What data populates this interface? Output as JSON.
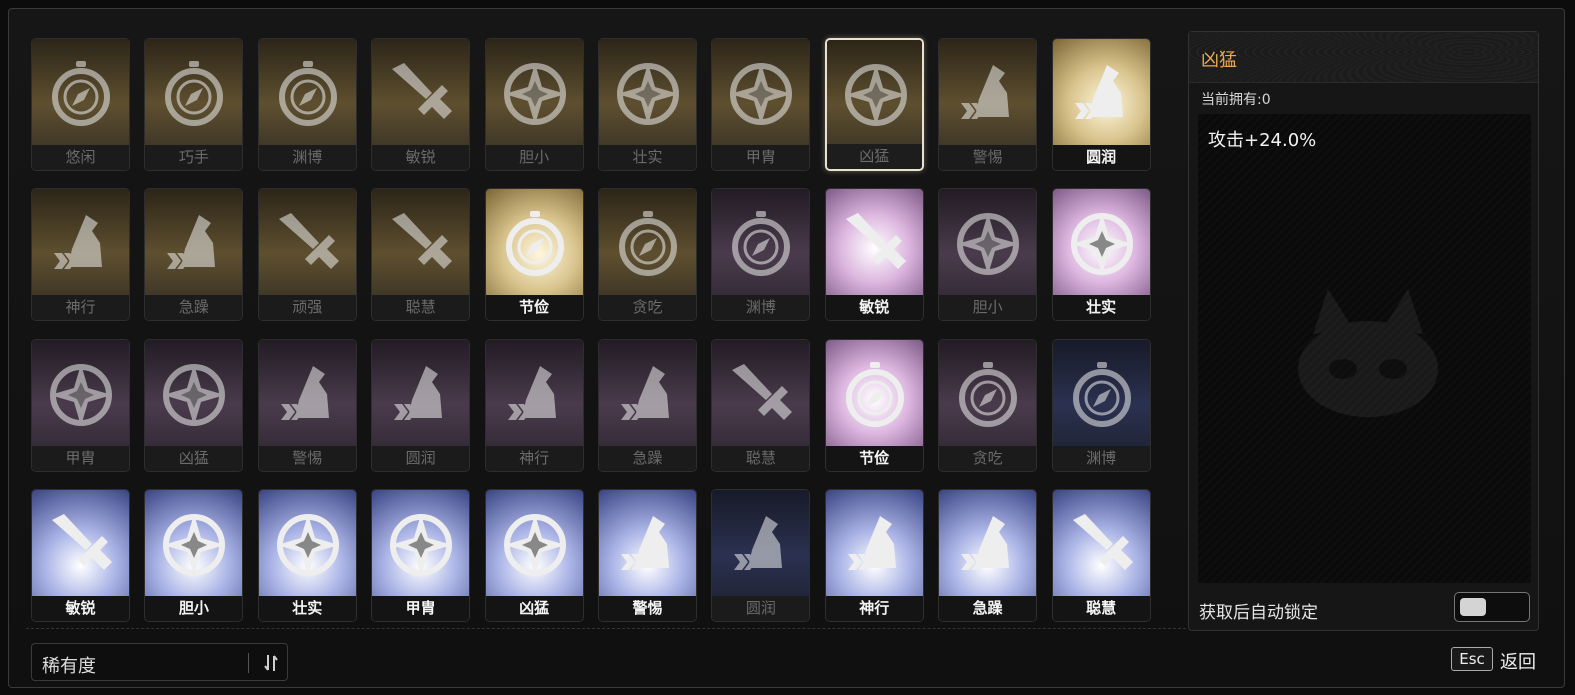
{
  "cards": [
    {
      "label": "悠闲",
      "icon": "compass-icon",
      "tint": "gold",
      "bright": false,
      "selected": false
    },
    {
      "label": "巧手",
      "icon": "compass-icon",
      "tint": "gold",
      "bright": false,
      "selected": false
    },
    {
      "label": "渊博",
      "icon": "compass-icon",
      "tint": "gold",
      "bright": false,
      "selected": false
    },
    {
      "label": "敏锐",
      "icon": "sword-icon",
      "tint": "gold",
      "bright": false,
      "selected": false
    },
    {
      "label": "胆小",
      "icon": "star-shield-icon",
      "tint": "gold",
      "bright": false,
      "selected": false
    },
    {
      "label": "壮实",
      "icon": "star-shield-icon",
      "tint": "gold",
      "bright": false,
      "selected": false
    },
    {
      "label": "甲胄",
      "icon": "star-shield-icon",
      "tint": "gold",
      "bright": false,
      "selected": false
    },
    {
      "label": "凶猛",
      "icon": "star-shield-icon",
      "tint": "gold",
      "bright": false,
      "selected": true
    },
    {
      "label": "警惕",
      "icon": "boot-icon",
      "tint": "gold",
      "bright": false,
      "selected": false
    },
    {
      "label": "圆润",
      "icon": "boot-icon",
      "tint": "gold",
      "bright": true,
      "selected": false
    },
    {
      "label": "神行",
      "icon": "boot-icon",
      "tint": "gold",
      "bright": false,
      "selected": false
    },
    {
      "label": "急躁",
      "icon": "boot-icon",
      "tint": "gold",
      "bright": false,
      "selected": false
    },
    {
      "label": "顽强",
      "icon": "sword-icon",
      "tint": "gold",
      "bright": false,
      "selected": false
    },
    {
      "label": "聪慧",
      "icon": "sword-icon",
      "tint": "gold",
      "bright": false,
      "selected": false
    },
    {
      "label": "节俭",
      "icon": "compass-icon",
      "tint": "gold",
      "bright": true,
      "selected": false
    },
    {
      "label": "贪吃",
      "icon": "compass-icon",
      "tint": "gold",
      "bright": false,
      "selected": false
    },
    {
      "label": "渊博",
      "icon": "compass-icon",
      "tint": "purple",
      "bright": false,
      "selected": false
    },
    {
      "label": "敏锐",
      "icon": "sword-icon",
      "tint": "purple",
      "bright": true,
      "selected": false
    },
    {
      "label": "胆小",
      "icon": "star-shield-icon",
      "tint": "purple",
      "bright": false,
      "selected": false
    },
    {
      "label": "壮实",
      "icon": "star-shield-icon",
      "tint": "purple",
      "bright": true,
      "selected": false
    },
    {
      "label": "甲胄",
      "icon": "star-shield-icon",
      "tint": "purple",
      "bright": false,
      "selected": false
    },
    {
      "label": "凶猛",
      "icon": "star-shield-icon",
      "tint": "purple",
      "bright": false,
      "selected": false
    },
    {
      "label": "警惕",
      "icon": "boot-icon",
      "tint": "purple",
      "bright": false,
      "selected": false
    },
    {
      "label": "圆润",
      "icon": "boot-icon",
      "tint": "purple",
      "bright": false,
      "selected": false
    },
    {
      "label": "神行",
      "icon": "boot-icon",
      "tint": "purple",
      "bright": false,
      "selected": false
    },
    {
      "label": "急躁",
      "icon": "boot-icon",
      "tint": "purple",
      "bright": false,
      "selected": false
    },
    {
      "label": "聪慧",
      "icon": "sword-icon",
      "tint": "purple",
      "bright": false,
      "selected": false
    },
    {
      "label": "节俭",
      "icon": "compass-icon",
      "tint": "purple",
      "bright": true,
      "selected": false
    },
    {
      "label": "贪吃",
      "icon": "compass-icon",
      "tint": "purple",
      "bright": false,
      "selected": false
    },
    {
      "label": "渊博",
      "icon": "compass-icon",
      "tint": "blue",
      "bright": false,
      "selected": false
    },
    {
      "label": "敏锐",
      "icon": "sword-icon",
      "tint": "blue",
      "bright": true,
      "selected": false
    },
    {
      "label": "胆小",
      "icon": "star-shield-icon",
      "tint": "blue",
      "bright": true,
      "selected": false
    },
    {
      "label": "壮实",
      "icon": "star-shield-icon",
      "tint": "blue",
      "bright": true,
      "selected": false
    },
    {
      "label": "甲胄",
      "icon": "star-shield-icon",
      "tint": "blue",
      "bright": true,
      "selected": false
    },
    {
      "label": "凶猛",
      "icon": "star-shield-icon",
      "tint": "blue",
      "bright": true,
      "selected": false
    },
    {
      "label": "警惕",
      "icon": "boot-icon",
      "tint": "blue",
      "bright": true,
      "selected": false
    },
    {
      "label": "圆润",
      "icon": "boot-icon",
      "tint": "blue",
      "bright": false,
      "selected": false
    },
    {
      "label": "神行",
      "icon": "boot-icon",
      "tint": "blue",
      "bright": true,
      "selected": false
    },
    {
      "label": "急躁",
      "icon": "boot-icon",
      "tint": "blue",
      "bright": true,
      "selected": false
    },
    {
      "label": "聪慧",
      "icon": "sword-icon",
      "tint": "blue",
      "bright": true,
      "selected": false
    }
  ],
  "sort": {
    "label": "稀有度",
    "icon": "sort-arrows-icon"
  },
  "detail": {
    "title": "凶猛",
    "owned": "当前拥有:0",
    "effect": "攻击+24.0%",
    "auto_lock_label": "获取后自动锁定",
    "watermark_icon": "paw-emblem-icon"
  },
  "footer": {
    "esc_key": "Esc",
    "back_label": "返回"
  },
  "colors": {
    "title_accent": "#e8aa52",
    "selected_border": "#e9e2cf"
  }
}
